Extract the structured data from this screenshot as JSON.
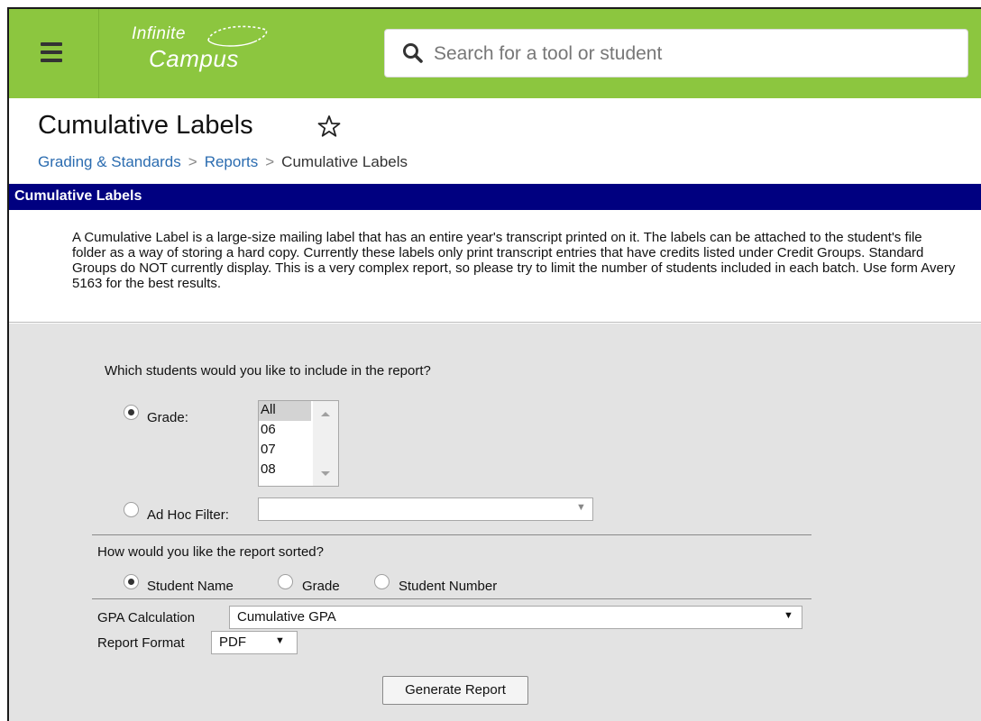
{
  "app": {
    "logo_line1": "Infinite",
    "logo_line2": "Campus",
    "search_placeholder": "Search for a tool or student"
  },
  "page": {
    "title": "Cumulative Labels",
    "breadcrumbs": [
      "Grading & Standards",
      "Reports",
      "Cumulative Labels"
    ],
    "section_header": "Cumulative Labels",
    "description": "A Cumulative Label is a large-size mailing label that has an entire year's transcript printed on it. The labels can be attached to the student's file folder as a way of storing a hard copy. Currently these labels only print transcript entries that have credits listed under Credit Groups. Standard Groups do NOT currently display. This is a very complex report, so please try to limit the number of students included in each batch. Use form Avery 5163 for the best results."
  },
  "form": {
    "students_question": "Which students would you like to include in the report?",
    "grade_label": "Grade:",
    "grade_options": [
      "All",
      "06",
      "07",
      "08"
    ],
    "grade_selected": "All",
    "adhoc_label": "Ad Hoc Filter:",
    "adhoc_value": "",
    "sort_question": "How would you like the report sorted?",
    "sort_options": [
      "Student Name",
      "Grade",
      "Student Number"
    ],
    "sort_selected": "Student Name",
    "gpa_label": "GPA Calculation",
    "gpa_value": "Cumulative GPA",
    "format_label": "Report Format",
    "format_value": "PDF",
    "generate_button": "Generate Report"
  },
  "colors": {
    "topbar": "#8cc63f",
    "section_header": "#000080",
    "link": "#2b6cb0",
    "form_background": "#e3e3e3"
  },
  "icons": [
    "menu-icon",
    "search-icon",
    "star-icon",
    "chevron-right-icon",
    "dropdown-arrow-icon"
  ]
}
